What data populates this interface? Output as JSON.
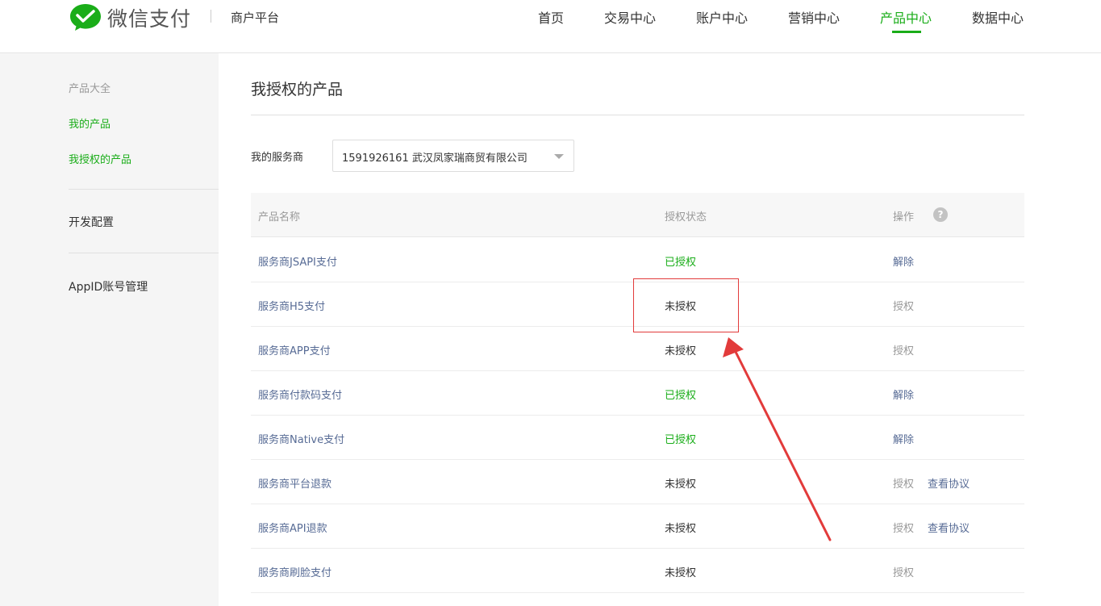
{
  "header": {
    "brand": "微信支付",
    "platform": "商户平台",
    "nav": [
      {
        "label": "首页",
        "active": false
      },
      {
        "label": "交易中心",
        "active": false
      },
      {
        "label": "账户中心",
        "active": false
      },
      {
        "label": "营销中心",
        "active": false
      },
      {
        "label": "产品中心",
        "active": true
      },
      {
        "label": "数据中心",
        "active": false
      }
    ]
  },
  "sidebar": {
    "group_title": "产品大全",
    "items": [
      {
        "label": "我的产品"
      },
      {
        "label": "我授权的产品"
      }
    ],
    "dev_config": "开发配置",
    "appid_manage": "AppID账号管理"
  },
  "main": {
    "title": "我授权的产品",
    "filter": {
      "label": "我的服务商",
      "selected": "1591926161 武汉凤家瑞商贸有限公司"
    },
    "table": {
      "columns": [
        "产品名称",
        "授权状态",
        "操作"
      ],
      "rows": [
        {
          "name": "服务商JSAPI支付",
          "status": "已授权",
          "op1": "解除",
          "op2": ""
        },
        {
          "name": "服务商H5支付",
          "status": "未授权",
          "op1": "授权",
          "op2": ""
        },
        {
          "name": "服务商APP支付",
          "status": "未授权",
          "op1": "授权",
          "op2": ""
        },
        {
          "name": "服务商付款码支付",
          "status": "已授权",
          "op1": "解除",
          "op2": ""
        },
        {
          "name": "服务商Native支付",
          "status": "已授权",
          "op1": "解除",
          "op2": ""
        },
        {
          "name": "服务商平台退款",
          "status": "未授权",
          "op1": "授权",
          "op2": "查看协议"
        },
        {
          "name": "服务商API退款",
          "status": "未授权",
          "op1": "授权",
          "op2": "查看协议"
        },
        {
          "name": "服务商刷脸支付",
          "status": "未授权",
          "op1": "授权",
          "op2": ""
        }
      ]
    }
  },
  "colors": {
    "accent": "#1aad19",
    "link": "#576b95",
    "annotation": "#e23b3b"
  },
  "icons": {
    "logo": "wechat-pay-logo-icon",
    "help": "question-circle-icon",
    "dropdown": "chevron-down-icon"
  }
}
